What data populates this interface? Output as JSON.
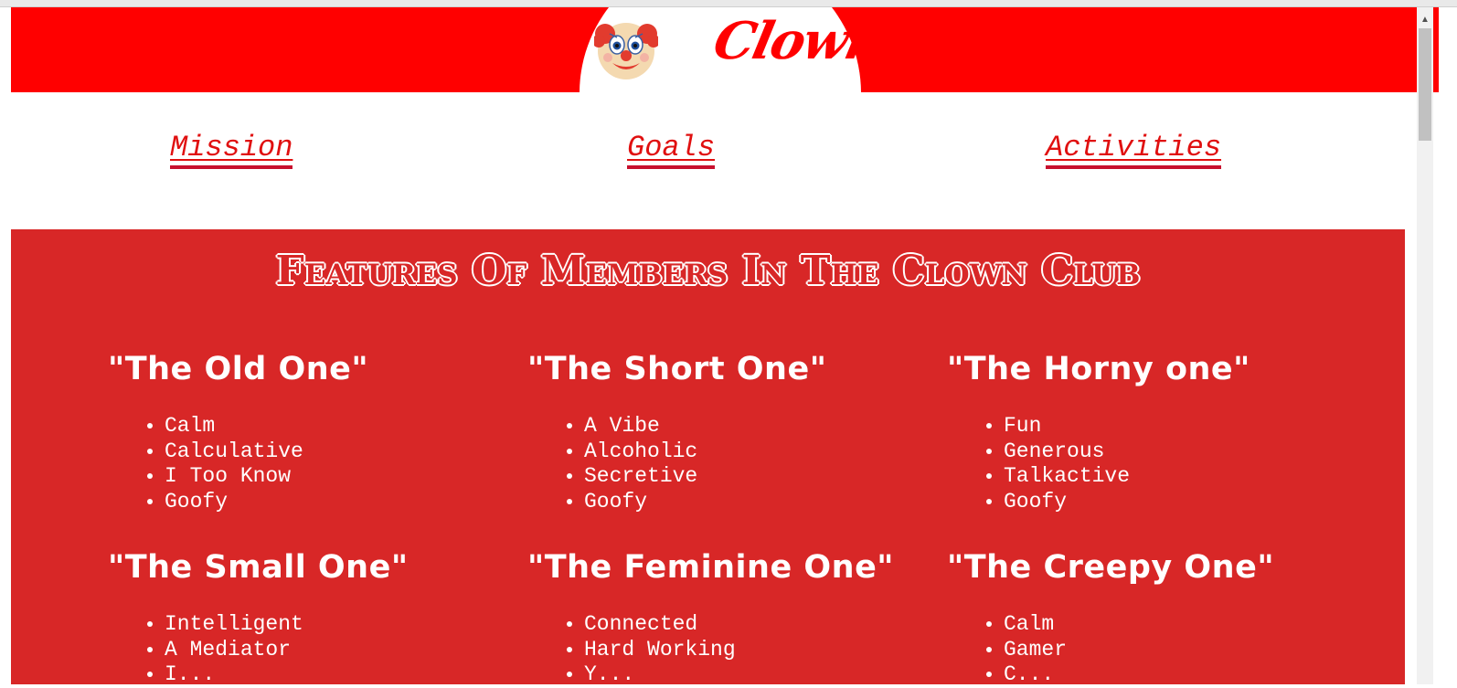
{
  "header": {
    "logo_emoji": "🤡",
    "logo_text": "Clowns",
    "brand_color": "#ff0000"
  },
  "nav": {
    "links": [
      {
        "label": "Mission"
      },
      {
        "label": "Goals"
      },
      {
        "label": "Activities"
      }
    ],
    "link_color": "#e01010"
  },
  "main": {
    "background": "#d82727",
    "title": "Features Of Members In The Clown Club",
    "members": [
      {
        "name": "\"The Old One\"",
        "traits": [
          "Calm",
          "Calculative",
          "I Too Know",
          "Goofy"
        ]
      },
      {
        "name": "\"The Short One\"",
        "traits": [
          "A Vibe",
          "Alcoholic",
          "Secretive",
          "Goofy"
        ]
      },
      {
        "name": "\"The Horny one\"",
        "traits": [
          "Fun",
          "Generous",
          "Talkactive",
          "Goofy"
        ]
      },
      {
        "name": "\"The Small One\"",
        "traits": [
          "Intelligent",
          "A Mediator",
          "I..."
        ]
      },
      {
        "name": "\"The Feminine One\"",
        "traits": [
          "Connected",
          "Hard Working",
          "Y..."
        ]
      },
      {
        "name": "\"The Creepy One\"",
        "traits": [
          "Calm",
          "Gamer",
          "C..."
        ]
      }
    ]
  }
}
